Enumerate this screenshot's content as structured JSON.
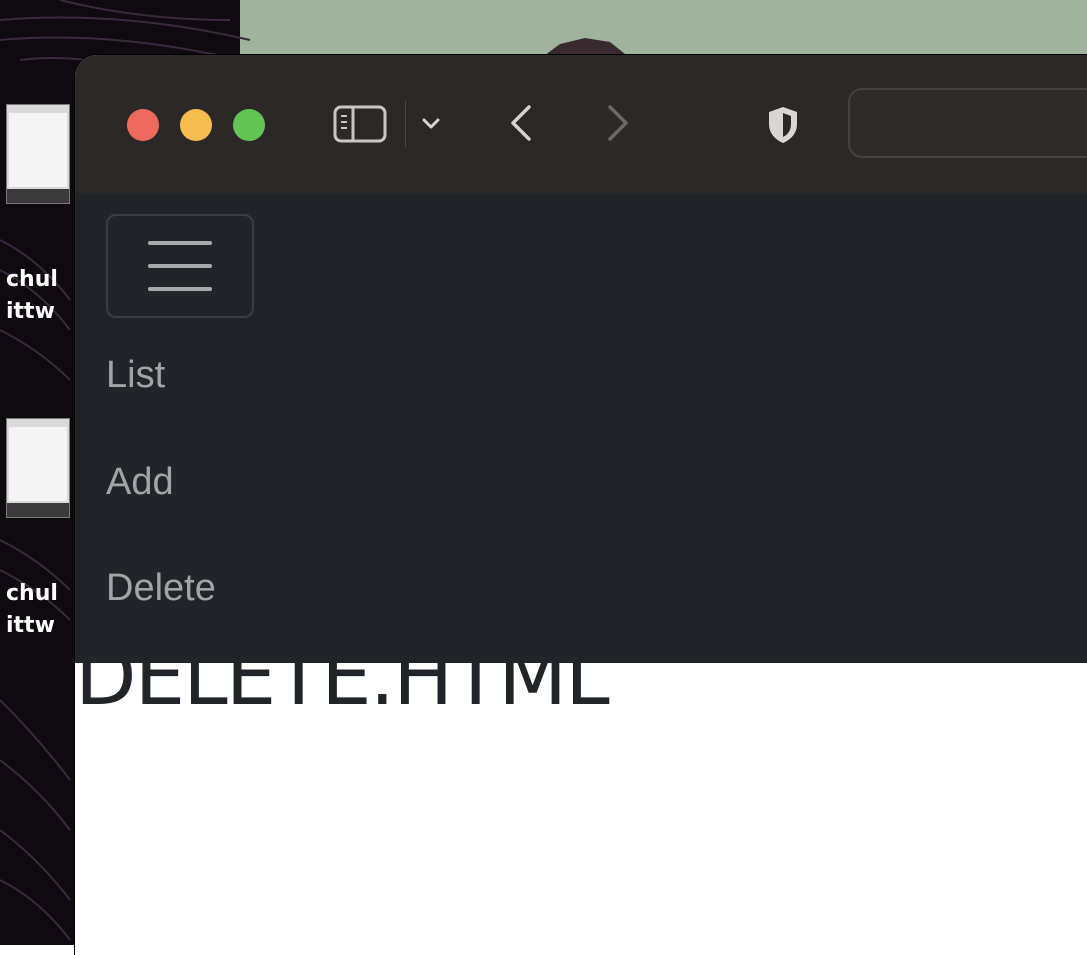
{
  "desktop": {
    "labels": [
      {
        "line1": "chul",
        "line2": "ittw"
      },
      {
        "line1": "chul",
        "line2": "ittw"
      }
    ]
  },
  "toolbar": {
    "traffic_colors": [
      "#ee6a5e",
      "#f5bd4f",
      "#61c454"
    ],
    "icons": [
      "sidebar-icon",
      "chevron-down-icon",
      "back-icon",
      "forward-icon",
      "shield-icon"
    ],
    "address_value": ""
  },
  "nav": {
    "items": [
      {
        "label": "List"
      },
      {
        "label": "Add"
      },
      {
        "label": "Delete"
      }
    ]
  },
  "main": {
    "heading": "DELETE.HTML"
  }
}
